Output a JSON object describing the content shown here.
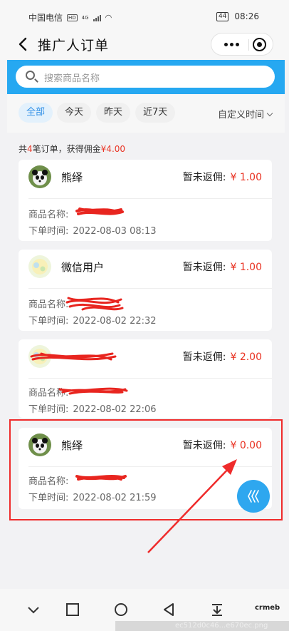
{
  "status": {
    "carrier": "中国电信",
    "hd": "HD",
    "net": "4G",
    "battery": "44",
    "time": "08:26"
  },
  "nav": {
    "title": "推广人订单"
  },
  "search": {
    "placeholder": "搜索商品名称"
  },
  "filters": {
    "chips": [
      "全部",
      "今天",
      "昨天",
      "近7天"
    ],
    "active_index": 0,
    "custom_time": "自定义时间"
  },
  "summary": {
    "prefix": "共",
    "count": "4",
    "middle": "笔订单，获得佣金",
    "amount": "¥4.00"
  },
  "orders": [
    {
      "user": "熊绎",
      "rebate_label": "暂未返佣:",
      "amount": "¥ 1.00",
      "product_label": "商品名称:",
      "product_value": "",
      "time_label": "下单时间:",
      "time_value": "2022-08-03 08:13"
    },
    {
      "user": "微信用户",
      "rebate_label": "暂未返佣:",
      "amount": "¥ 1.00",
      "product_label": "商品名称:",
      "product_value": "",
      "time_label": "下单时间:",
      "time_value": "2022-08-02 22:32"
    },
    {
      "user": "",
      "rebate_label": "暂未返佣:",
      "amount": "¥ 2.00",
      "product_label": "商品名称:",
      "product_value": "",
      "time_label": "下单时间:",
      "time_value": "2022-08-02 22:06"
    },
    {
      "user": "熊绎",
      "rebate_label": "暂未返佣:",
      "amount": "¥ 0.00",
      "product_label": "商品名称:",
      "product_value": "",
      "time_label": "下单时间:",
      "time_value": "2022-08-02 21:59"
    }
  ],
  "footer": {
    "brand": "crmeb",
    "watermark": "ec512d0c46...e670ec.png"
  },
  "colors": {
    "accent": "#26a8f1",
    "price": "#e93323",
    "annotation": "#ef2b2b",
    "chip_active_text": "#2f8fe6"
  }
}
